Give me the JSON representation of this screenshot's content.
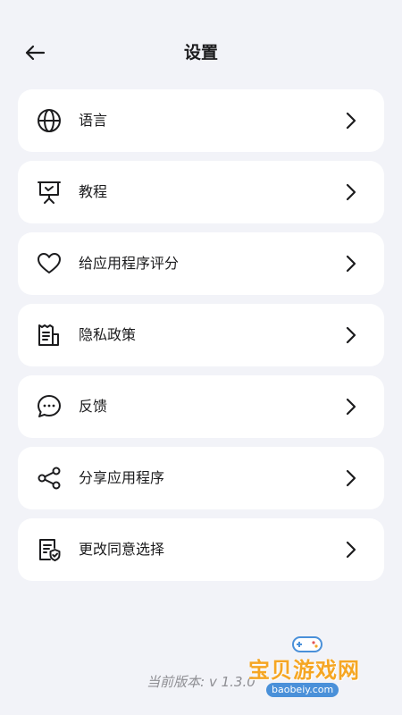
{
  "header": {
    "title": "设置",
    "back_icon": "arrow-left-icon"
  },
  "settings": {
    "items": [
      {
        "label": "语言",
        "icon": "globe-icon"
      },
      {
        "label": "教程",
        "icon": "presentation-board-icon"
      },
      {
        "label": "给应用程序评分",
        "icon": "heart-icon"
      },
      {
        "label": "隐私政策",
        "icon": "receipt-document-icon"
      },
      {
        "label": "反馈",
        "icon": "chat-bubble-icon"
      },
      {
        "label": "分享应用程序",
        "icon": "share-icon"
      },
      {
        "label": "更改同意选择",
        "icon": "document-shield-icon"
      }
    ]
  },
  "footer": {
    "version": "当前版本: v 1.3.0"
  },
  "watermark": {
    "title": "宝贝游戏网",
    "url": "baobeiy.com"
  },
  "colors": {
    "background": "#f2f3f8",
    "card": "#ffffff",
    "text": "#1c1c1e",
    "muted": "#8e8e93",
    "watermark": "#f5a623"
  }
}
